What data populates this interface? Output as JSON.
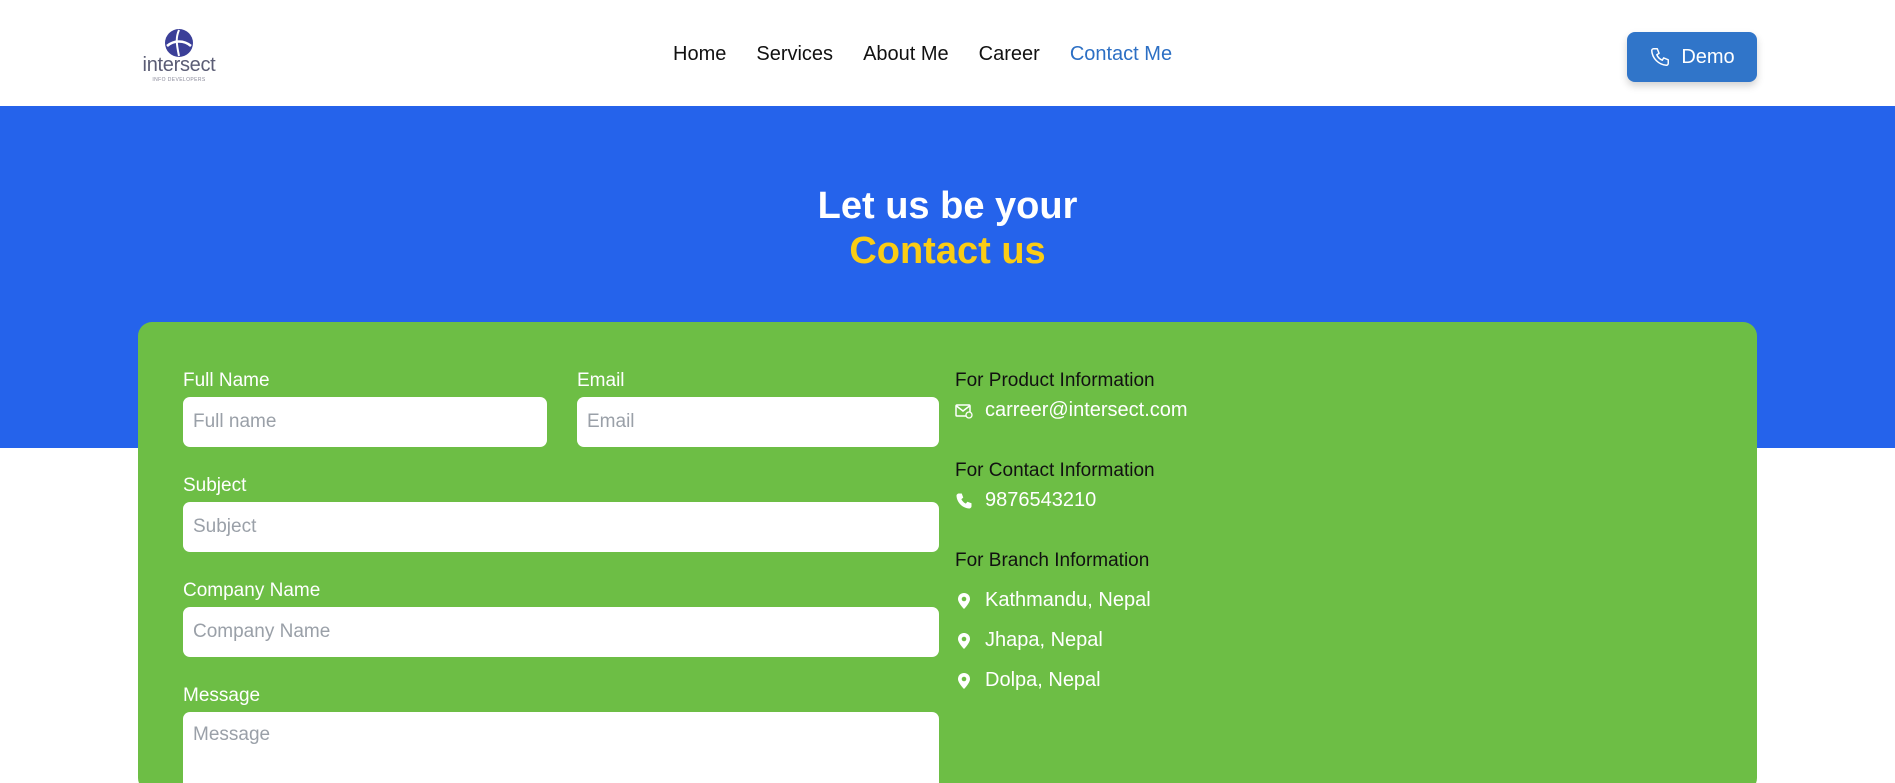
{
  "brand": {
    "name": "intersect",
    "tagline": "INFO DEVELOPERS",
    "logo_color": "#3b3f98"
  },
  "nav": {
    "items": [
      {
        "label": "Home",
        "active": false
      },
      {
        "label": "Services",
        "active": false
      },
      {
        "label": "About Me",
        "active": false
      },
      {
        "label": "Career",
        "active": false
      },
      {
        "label": "Contact Me",
        "active": true
      }
    ]
  },
  "header": {
    "demo_label": "Demo",
    "demo_icon": "phone-icon"
  },
  "hero": {
    "title": "Let us be your",
    "accent": "Contact us",
    "background": "#2563eb",
    "accent_color": "#facc15"
  },
  "form": {
    "full_name": {
      "label": "Full Name",
      "placeholder": "Full name",
      "value": ""
    },
    "email": {
      "label": "Email",
      "placeholder": "Email",
      "value": ""
    },
    "subject": {
      "label": "Subject",
      "placeholder": "Subject",
      "value": ""
    },
    "company": {
      "label": "Company Name",
      "placeholder": "Company Name",
      "value": ""
    },
    "message": {
      "label": "Message",
      "placeholder": "Message",
      "value": ""
    }
  },
  "info": {
    "product": {
      "heading": "For Product Information",
      "email": "carreer@intersect.com",
      "icon": "mail-icon"
    },
    "contact": {
      "heading": "For Contact Information",
      "phone": "9876543210",
      "icon": "phone-icon"
    },
    "branch": {
      "heading": "For Branch Information",
      "icon": "location-pin-icon",
      "locations": [
        "Kathmandu, Nepal",
        "Jhapa, Nepal",
        "Dolpa, Nepal"
      ]
    }
  },
  "colors": {
    "card_green": "#6dbe45",
    "button_blue": "#3075c9",
    "active_nav": "#2c6fc4"
  }
}
